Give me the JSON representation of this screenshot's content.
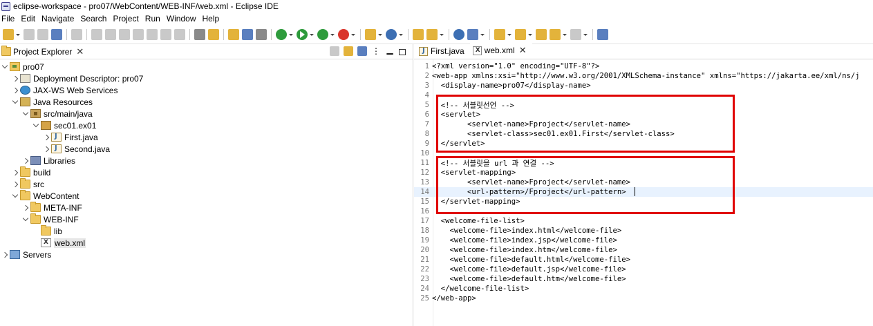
{
  "window": {
    "title": "eclipse-workspace - pro07/WebContent/WEB-INF/web.xml - Eclipse IDE"
  },
  "menubar": {
    "items": [
      "File",
      "Edit",
      "Navigate",
      "Search",
      "Project",
      "Run",
      "Window",
      "Help"
    ]
  },
  "explorer": {
    "tab_label": "Project Explorer",
    "tree": [
      {
        "label": "pro07",
        "icon": "project-icon",
        "expanded": true
      },
      {
        "label": "Deployment Descriptor: pro07",
        "icon": "deployment-descriptor-icon",
        "expanded": false
      },
      {
        "label": "JAX-WS Web Services",
        "icon": "web-services-icon",
        "expanded": false
      },
      {
        "label": "Java Resources",
        "icon": "java-resources-icon",
        "expanded": true
      },
      {
        "label": "src/main/java",
        "icon": "source-folder-icon",
        "expanded": true
      },
      {
        "label": "sec01.ex01",
        "icon": "package-icon",
        "expanded": true
      },
      {
        "label": "First.java",
        "icon": "java-file-icon",
        "expanded": false
      },
      {
        "label": "Second.java",
        "icon": "java-file-icon",
        "expanded": false
      },
      {
        "label": "Libraries",
        "icon": "libraries-icon",
        "expanded": false
      },
      {
        "label": "build",
        "icon": "folder-icon",
        "expanded": false
      },
      {
        "label": "src",
        "icon": "folder-icon",
        "expanded": false
      },
      {
        "label": "WebContent",
        "icon": "folder-icon",
        "expanded": true
      },
      {
        "label": "META-INF",
        "icon": "folder-icon",
        "expanded": false
      },
      {
        "label": "WEB-INF",
        "icon": "folder-icon",
        "expanded": true
      },
      {
        "label": "lib",
        "icon": "folder-icon",
        "expanded": null
      },
      {
        "label": "web.xml",
        "icon": "xml-file-icon",
        "expanded": null,
        "selected": true
      },
      {
        "label": "Servers",
        "icon": "servers-icon",
        "expanded": false
      }
    ]
  },
  "editor": {
    "tabs": [
      {
        "label": "First.java",
        "icon": "java-file-icon",
        "active": false
      },
      {
        "label": "web.xml",
        "icon": "xml-file-icon",
        "active": true
      }
    ],
    "lines": [
      {
        "n": "1",
        "text": "<?xml version=\"1.0\" encoding=\"UTF-8\"?>"
      },
      {
        "n": "2",
        "text": "<web-app xmlns:xsi=\"http://www.w3.org/2001/XMLSchema-instance\" xmlns=\"https://jakarta.ee/xml/ns/j"
      },
      {
        "n": "3",
        "text": "  <display-name>pro07</display-name>"
      },
      {
        "n": "4",
        "text": ""
      },
      {
        "n": "5",
        "text": "  <!-- 서블릿선언 -->"
      },
      {
        "n": "6",
        "text": "  <servlet>"
      },
      {
        "n": "7",
        "text": "        <servlet-name>Fproject</servlet-name>"
      },
      {
        "n": "8",
        "text": "        <servlet-class>sec01.ex01.First</servlet-class>"
      },
      {
        "n": "9",
        "text": "  </servlet>"
      },
      {
        "n": "10",
        "text": ""
      },
      {
        "n": "11",
        "text": "  <!-- 서블릿을 url 과 연결 -->"
      },
      {
        "n": "12",
        "text": "  <servlet-mapping>"
      },
      {
        "n": "13",
        "text": "        <servlet-name>Fproject</servlet-name>"
      },
      {
        "n": "14",
        "text": "        <url-pattern>/Fproject</url-pattern>",
        "current": true
      },
      {
        "n": "15",
        "text": "  </servlet-mapping>"
      },
      {
        "n": "16",
        "text": ""
      },
      {
        "n": "17",
        "text": "  <welcome-file-list>"
      },
      {
        "n": "18",
        "text": "    <welcome-file>index.html</welcome-file>"
      },
      {
        "n": "19",
        "text": "    <welcome-file>index.jsp</welcome-file>"
      },
      {
        "n": "20",
        "text": "    <welcome-file>index.htm</welcome-file>"
      },
      {
        "n": "21",
        "text": "    <welcome-file>default.html</welcome-file>"
      },
      {
        "n": "22",
        "text": "    <welcome-file>default.jsp</welcome-file>"
      },
      {
        "n": "23",
        "text": "    <welcome-file>default.htm</welcome-file>"
      },
      {
        "n": "24",
        "text": "  </welcome-file-list>"
      },
      {
        "n": "25",
        "text": "</web-app>"
      }
    ]
  },
  "colors": {
    "highlight_box": "#e00000",
    "current_line": "#e8f2fe",
    "selection": "#e7e7e7"
  }
}
